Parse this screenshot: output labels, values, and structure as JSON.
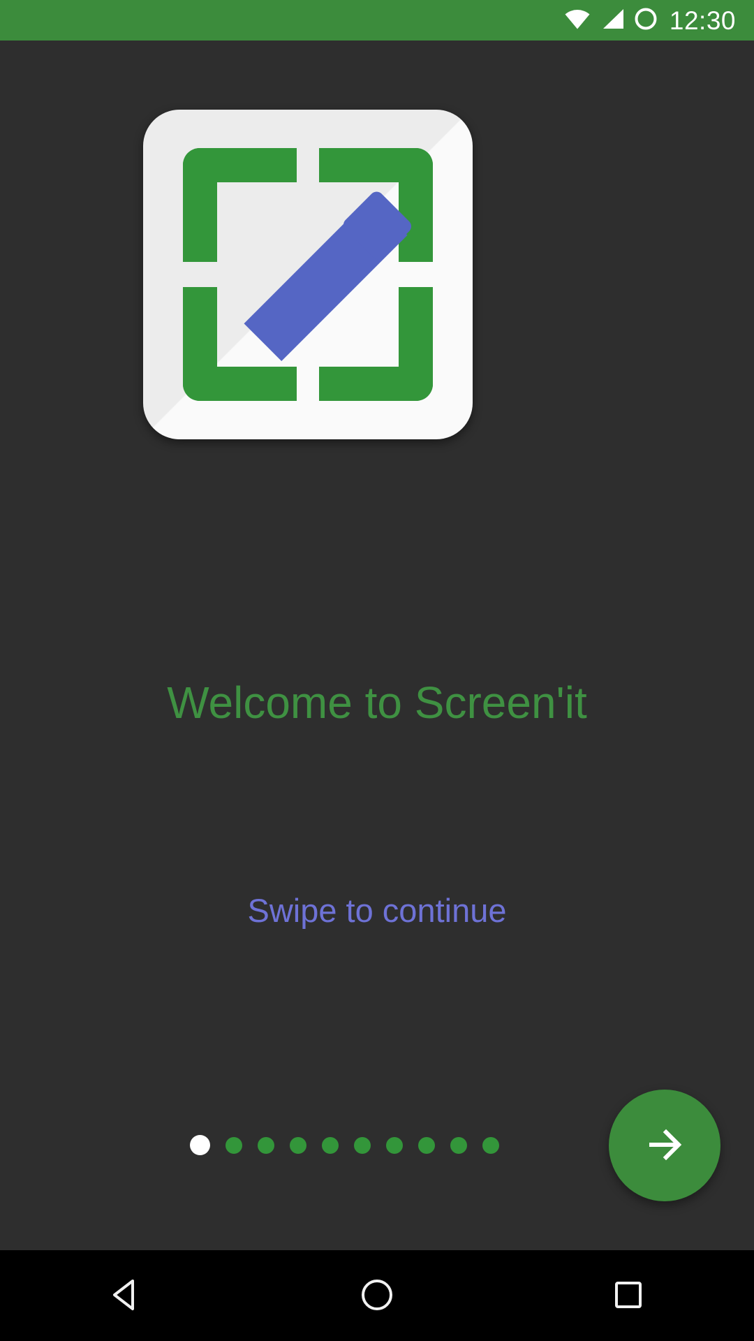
{
  "status_bar": {
    "background_color": "#3c8c3c",
    "clock": "12:30",
    "icons": [
      "wifi-icon",
      "cell-signal-icon",
      "circle-indicator-icon"
    ]
  },
  "app": {
    "background_color": "#2e2e2e",
    "icon": {
      "name": "screenit-app-icon",
      "plate_color": "#fafafa",
      "bracket_color": "#33963a",
      "pencil_color": "#5566c4"
    }
  },
  "content": {
    "title": "Welcome to Screen'it",
    "title_color": "#3f9142",
    "subtitle": "Swipe to continue",
    "subtitle_color": "#6e72d6"
  },
  "pager": {
    "total_pages": 10,
    "current_page": 1,
    "active_dot_color": "#ffffff",
    "inactive_dot_color": "#33963a"
  },
  "fab": {
    "label": "next-page",
    "icon": "arrow-right-icon",
    "background_color": "#3c8c3c",
    "icon_color": "#ffffff"
  },
  "nav_bar": {
    "background_color": "#000000",
    "buttons": [
      {
        "name": "back-button",
        "icon": "triangle-left-icon"
      },
      {
        "name": "home-button",
        "icon": "circle-icon"
      },
      {
        "name": "recents-button",
        "icon": "square-icon"
      }
    ]
  }
}
